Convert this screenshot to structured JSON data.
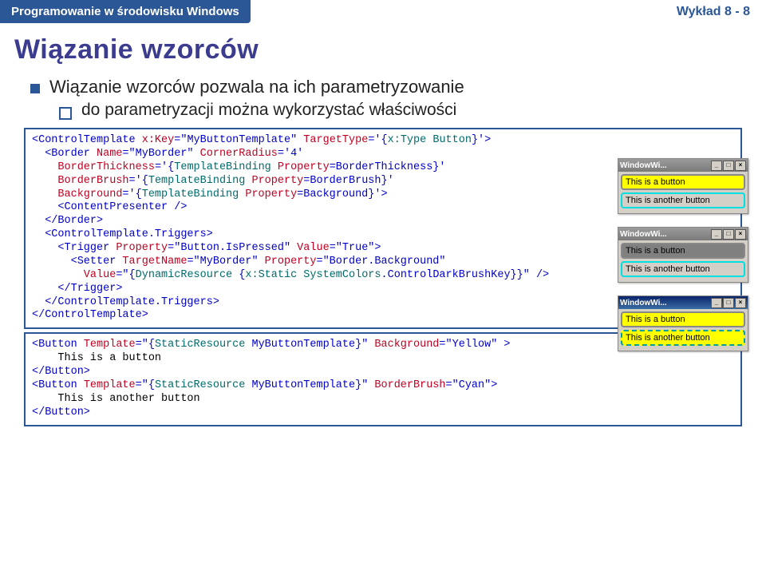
{
  "header": {
    "course": "Programowanie w środowisku Windows",
    "lecture": "Wykład 8 - 8"
  },
  "title": "Wiązanie wzorców",
  "bullets": {
    "main": "Wiązanie wzorców pozwala na ich parametryzowanie",
    "sub": "do parametryzacji można wykorzystać właściwości"
  },
  "code1": {
    "l1a": "<ControlTemplate ",
    "l1b": "x:Key",
    "l1c": "=\"MyButtonTemplate\"",
    "l1d": " TargetType",
    "l1e": "='{",
    "l1f": "x:Type ",
    "l1g": "Button",
    "l1h": "}'>",
    "l2a": "  <Border ",
    "l2b": "Name",
    "l2c": "=\"MyBorder\"",
    "l2d": " CornerRadius",
    "l2e": "='4'",
    "l3a": "    BorderThickness",
    "l3b": "='{",
    "l3c": "TemplateBinding ",
    "l3d": "Property",
    "l3e": "=BorderThickness}'",
    "l4a": "    BorderBrush",
    "l4b": "='{",
    "l4c": "TemplateBinding ",
    "l4d": "Property",
    "l4e": "=BorderBrush}'",
    "l5a": "    Background",
    "l5b": "='{",
    "l5c": "TemplateBinding ",
    "l5d": "Property",
    "l5e": "=Background}'>",
    "l6": "    <ContentPresenter />",
    "l7": "  </Border>",
    "l8": "  <ControlTemplate.Triggers>",
    "l9a": "    <Trigger ",
    "l9b": "Property",
    "l9c": "=\"Button.IsPressed\"",
    "l9d": " Value",
    "l9e": "=\"True\">",
    "l10a": "      <Setter ",
    "l10b": "TargetName",
    "l10c": "=\"MyBorder\"",
    "l10d": " Property",
    "l10e": "=\"Border.Background\"",
    "l11a": "        Value",
    "l11b": "=\"{",
    "l11c": "DynamicResource ",
    "l11d": "{",
    "l11e": "x:Static ",
    "l11f": "SystemColors",
    "l11g": ".ControlDarkBrushKey}}\" />",
    "l12": "    </Trigger>",
    "l13": "  </ControlTemplate.Triggers>",
    "l14": "</ControlTemplate>"
  },
  "code2": {
    "l1a": "<Button ",
    "l1b": "Template",
    "l1c": "=\"{",
    "l1d": "StaticResource ",
    "l1e": "MyButtonTemplate}\"",
    "l1f": " Background",
    "l1g": "=\"Yellow\" >",
    "l2": "    This is a button",
    "l3": "</Button>",
    "l4a": "<Button ",
    "l4b": "Template",
    "l4c": "=\"{",
    "l4d": "StaticResource ",
    "l4e": "MyButtonTemplate}\"",
    "l4f": " BorderBrush",
    "l4g": "=\"Cyan\">",
    "l5": "    This is another button",
    "l6": "</Button>"
  },
  "windows": {
    "title": "WindowWi...",
    "btn1": "This is a button",
    "btn2": "This is another button"
  }
}
